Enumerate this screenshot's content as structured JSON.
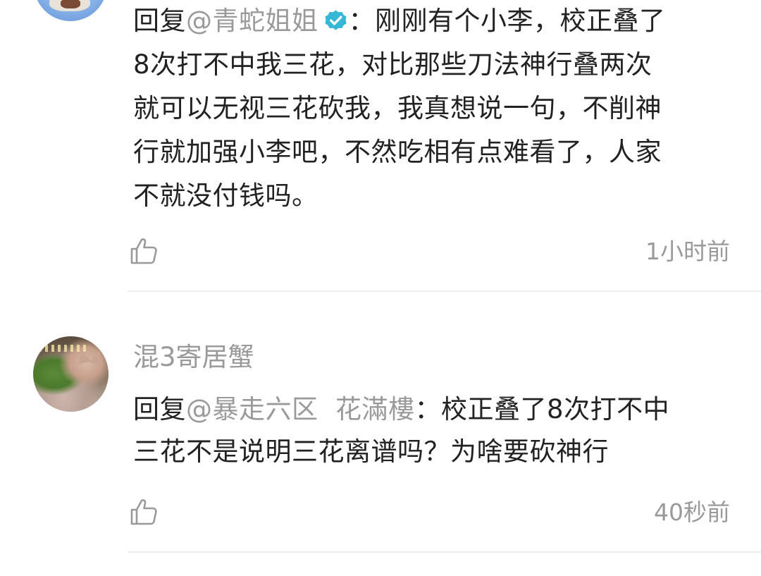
{
  "comments": [
    {
      "reply_prefix": "回复",
      "mention": "@青蛇姐姐",
      "separator": "：",
      "lines": [
        "刚刚有个小李，校正叠了",
        "8次打不中我三花，对比那些刀法神行叠两次",
        "就可以无视三花砍我，我真想说一句，不削神",
        "行就加强小李吧，不然吃相有点难看了，人家",
        "不就没付钱吗。"
      ],
      "time": "1小时前",
      "verified_badge": {
        "icon": "verified-check-icon",
        "color": "#35b7d6"
      }
    },
    {
      "username": "混3寄居蟹",
      "reply_prefix": "回复",
      "mention": "@暴走六区  花滿樓",
      "separator": "：",
      "lines": [
        "校正叠了8次打不中",
        "三花不是说明三花离谱吗？为啥要砍神行"
      ],
      "time": "40秒前"
    }
  ],
  "icons": {
    "like": "thumbs-up-icon"
  },
  "colors": {
    "text": "#222222",
    "muted": "#9a9a9a",
    "divider": "#ececec"
  }
}
